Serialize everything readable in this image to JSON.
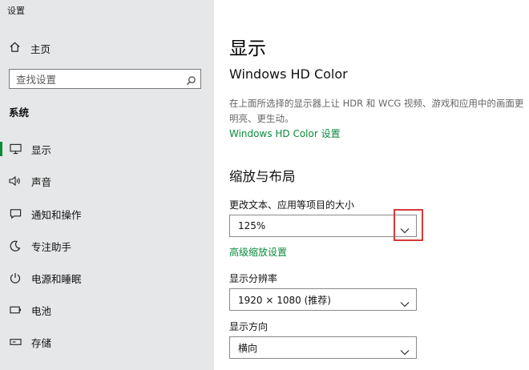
{
  "window": {
    "title": "设置"
  },
  "sidebar": {
    "home_label": "主页",
    "search_placeholder": "查找设置",
    "section_title": "系统",
    "items": [
      {
        "label": "显示",
        "icon": "monitor-icon",
        "selected": true
      },
      {
        "label": "声音",
        "icon": "speaker-icon"
      },
      {
        "label": "通知和操作",
        "icon": "notification-icon"
      },
      {
        "label": "专注助手",
        "icon": "moon-icon"
      },
      {
        "label": "电源和睡眠",
        "icon": "power-icon"
      },
      {
        "label": "电池",
        "icon": "battery-icon"
      },
      {
        "label": "存储",
        "icon": "storage-icon"
      }
    ]
  },
  "main": {
    "title": "显示",
    "hd_title": "Windows HD Color",
    "hd_desc": "在上面所选择的显示器上让 HDR 和 WCG 视频、游戏和应用中的画面更明亮、更生动。",
    "hd_link": "Windows HD Color 设置",
    "scale_section": "缩放与布局",
    "scale_label": "更改文本、应用等项目的大小",
    "scale_value": "125%",
    "advanced_scaling_link": "高级缩放设置",
    "resolution_label": "显示分辨率",
    "resolution_value": "1920 × 1080 (推荐)",
    "orientation_label": "显示方向",
    "orientation_value": "横向"
  },
  "colors": {
    "accent": "#0b8a3c",
    "highlight": "#d63a3a",
    "sidebar_bg": "#e6e7e8"
  }
}
